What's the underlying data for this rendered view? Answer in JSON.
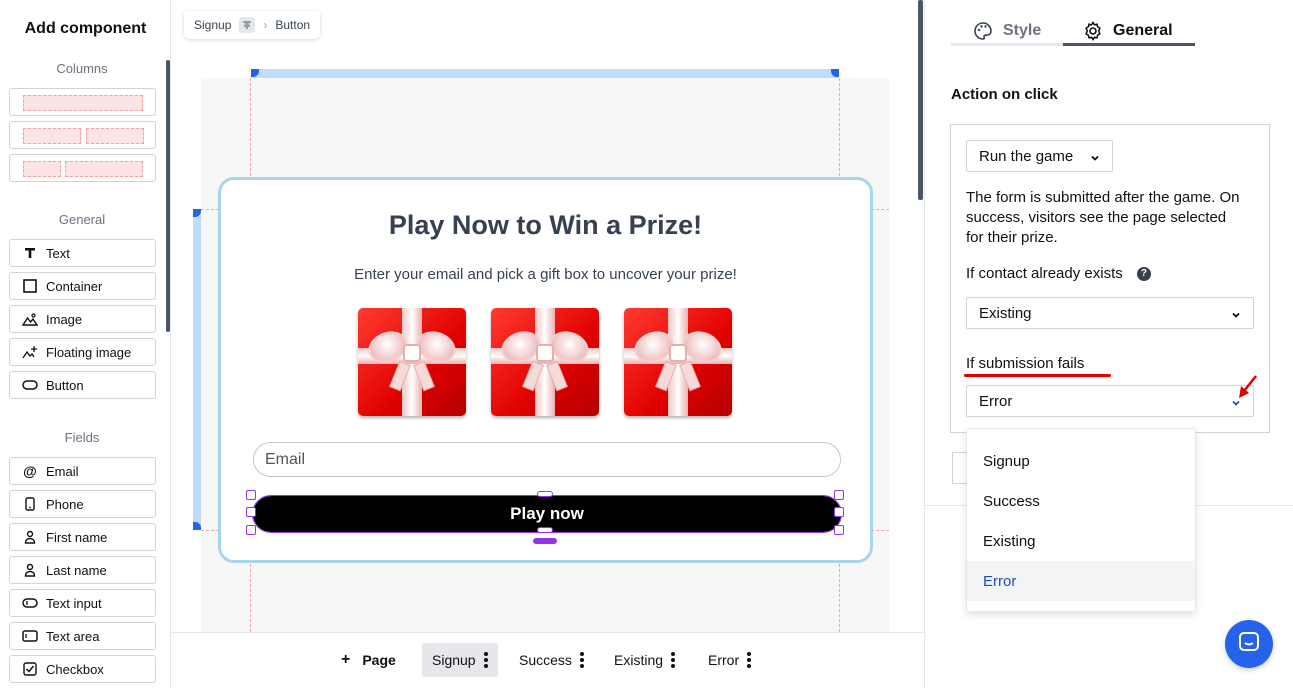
{
  "sidebar": {
    "title": "Add component",
    "sections": {
      "columns": "Columns",
      "general": "General",
      "fields": "Fields"
    },
    "general_items": [
      {
        "label": "Text",
        "icon": "text-icon"
      },
      {
        "label": "Container",
        "icon": "container-icon"
      },
      {
        "label": "Image",
        "icon": "image-icon"
      },
      {
        "label": "Floating image",
        "icon": "floating-image-icon"
      },
      {
        "label": "Button",
        "icon": "button-icon"
      }
    ],
    "field_items": [
      {
        "label": "Email",
        "icon": "at-icon"
      },
      {
        "label": "Phone",
        "icon": "phone-icon"
      },
      {
        "label": "First name",
        "icon": "person-icon"
      },
      {
        "label": "Last name",
        "icon": "person-icon"
      },
      {
        "label": "Text input",
        "icon": "text-input-icon"
      },
      {
        "label": "Text area",
        "icon": "text-area-icon"
      },
      {
        "label": "Checkbox",
        "icon": "checkbox-icon"
      }
    ]
  },
  "breadcrumb": {
    "page": "Signup",
    "element": "Button"
  },
  "canvas": {
    "title": "Play Now to Win a Prize!",
    "subtitle": "Enter your email and pick a gift box to uncover your prize!",
    "email_placeholder": "Email",
    "play_button": "Play now"
  },
  "pages": {
    "add_label": "Page",
    "items": [
      "Signup",
      "Success",
      "Existing",
      "Error"
    ],
    "active": "Signup"
  },
  "panel": {
    "tabs": [
      "Style",
      "General"
    ],
    "active_tab": "General",
    "section_title": "Action on click",
    "action_select": "Run the game",
    "description": "The form is submitted after the game. On success, visitors see the page selected for their prize.",
    "contact_exists_label": "If contact already exists",
    "contact_exists_value": "Existing",
    "fail_label": "If submission fails",
    "fail_value": "Error",
    "dropdown_options": [
      "Signup",
      "Success",
      "Existing",
      "Error"
    ],
    "dropdown_selected": "Error"
  },
  "colors": {
    "accent": "#2563eb",
    "selection": "#9333ea",
    "card_border": "#a8d4ec",
    "annotation_red": "#e00000"
  }
}
